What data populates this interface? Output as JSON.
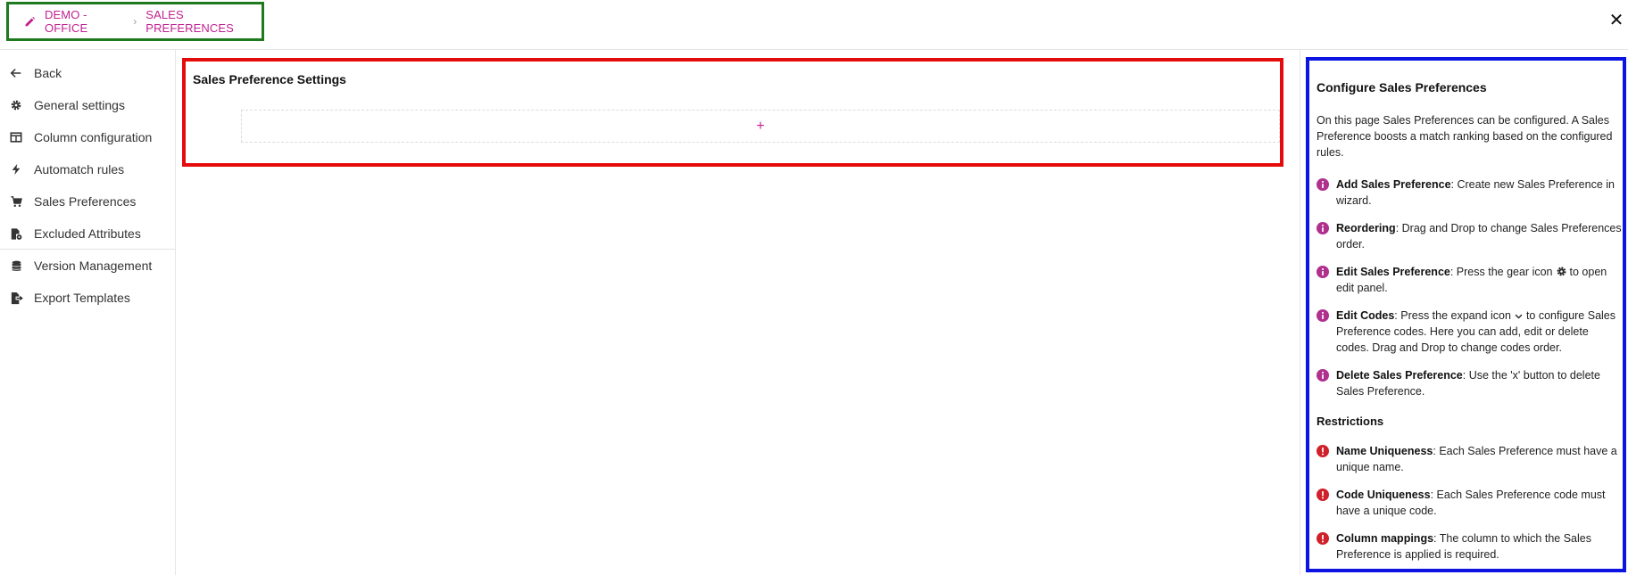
{
  "header": {
    "breadcrumb": [
      "DEMO - OFFICE",
      "SALES PREFERENCES"
    ],
    "close_label": "✕"
  },
  "sidebar": {
    "items": [
      {
        "label": "Back",
        "icon": "arrow-left-icon"
      },
      {
        "label": "General settings",
        "icon": "gear-icon"
      },
      {
        "label": "Column configuration",
        "icon": "columns-icon"
      },
      {
        "label": "Automatch rules",
        "icon": "bolt-icon"
      },
      {
        "label": "Sales Preferences",
        "icon": "cart-icon"
      },
      {
        "label": "Excluded Attributes",
        "icon": "file-settings-icon"
      },
      {
        "label": "Version Management",
        "icon": "database-icon"
      },
      {
        "label": "Export Templates",
        "icon": "file-export-icon"
      }
    ]
  },
  "main": {
    "title": "Sales Preference Settings",
    "add_label": "+"
  },
  "help": {
    "title": "Configure Sales Preferences",
    "intro": "On this page Sales Preferences can be configured. A Sales Preference boosts a match ranking based on the configured rules.",
    "info_items": [
      {
        "title": "Add Sales Preference",
        "text": ": Create new Sales Preference in wizard."
      },
      {
        "title": "Reordering",
        "text": ": Drag and Drop to change Sales Preferences order."
      },
      {
        "title": "Edit Sales Preference",
        "text_before": ": Press the gear icon",
        "text_after": "to open edit panel."
      },
      {
        "title": "Edit Codes",
        "text_before": ": Press the expand icon",
        "text_after": "to configure Sales Preference codes. Here you can add, edit or delete codes. Drag and Drop to change codes order."
      },
      {
        "title": "Delete Sales Preference",
        "text": ": Use the 'x' button to delete Sales Preference."
      }
    ],
    "restrictions_title": "Restrictions",
    "restrictions": [
      {
        "title": "Name Uniqueness",
        "text": ": Each Sales Preference must have a unique name."
      },
      {
        "title": "Code Uniqueness",
        "text": ": Each Sales Preference code must have a unique code."
      },
      {
        "title": "Column mappings",
        "text": ": The column to which the Sales Preference is applied is required."
      }
    ]
  },
  "colors": {
    "accent": "#c0218f",
    "info": "#b0308e",
    "error": "#d0202a",
    "outline_green": "#1f7a1f",
    "outline_red": "#e30b0b",
    "outline_blue": "#0b14e0"
  }
}
